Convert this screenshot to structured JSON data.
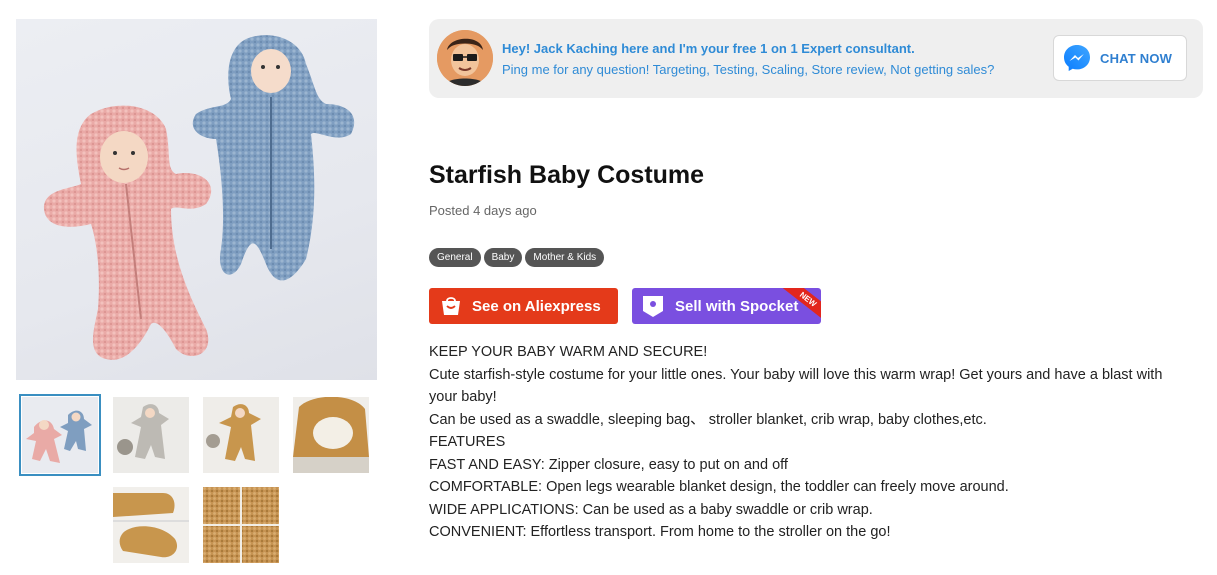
{
  "banner": {
    "line1": "Hey! Jack Kaching here and I'm your free 1 on 1 Expert consultant.",
    "line2": "Ping me for any question! Targeting, Testing, Scaling, Store review, Not getting sales?",
    "chat_label": "CHAT NOW",
    "accent_color": "#2f8bd6"
  },
  "product": {
    "title": "Starfish Baby Costume",
    "posted": "Posted 4 days ago",
    "tags": [
      "General",
      "Baby",
      "Mother & Kids"
    ],
    "aliexpress_label": "See on Aliexpress",
    "spocket_label": "Sell with Spocket",
    "spocket_badge": "NEW",
    "description": [
      "KEEP YOUR BABY WARM AND SECURE!",
      "Cute starfish-style costume for your little ones. Your baby will love this warm wrap! Get yours and have a blast with your baby!",
      "Can be used as a swaddle, sleeping bag、 stroller blanket, crib wrap, baby clothes,etc.",
      "FEATURES",
      "FAST AND EASY: Zipper closure, easy to put on and off",
      "COMFORTABLE: Open legs wearable blanket design, the toddler can freely move around.",
      "WIDE APPLICATIONS: Can be used as a baby swaddle or crib wrap.",
      "CONVENIENT: Effortless transport. From home to the stroller on the go!"
    ]
  },
  "gallery": {
    "main_image": "starfish-costume-pink-and-blue-photo",
    "thumbnails": [
      "pink-and-blue-costumes",
      "grey-costume",
      "brown-costume",
      "hood-closeup",
      "foot-closeup",
      "fabric-closeup"
    ],
    "selected_index": 0
  },
  "colors": {
    "aliexpress_red": "#e43a1a",
    "spocket_purple": "#7a4fe0",
    "tag_grey": "#555555",
    "pink_costume": "#e9aaa6",
    "blue_costume": "#7f9ec0"
  }
}
